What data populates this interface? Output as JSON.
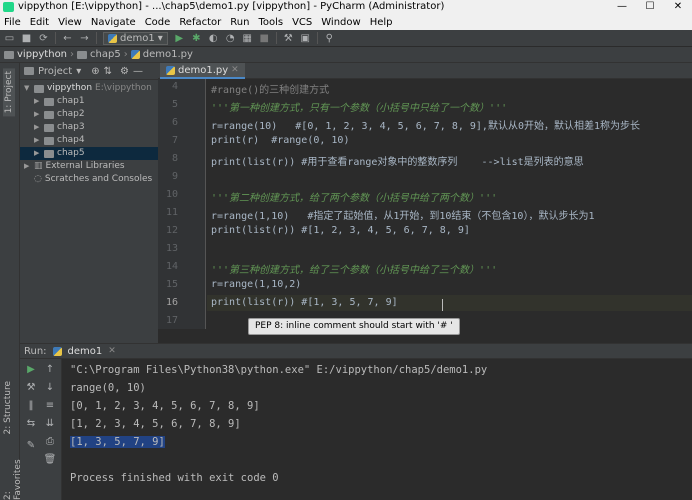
{
  "window": {
    "title": "vippython [E:\\vippython] - ...\\chap5\\demo1.py [vippython] - PyCharm (Administrator)",
    "controls": [
      "—",
      "☐",
      "✕"
    ]
  },
  "menu": [
    "File",
    "Edit",
    "View",
    "Navigate",
    "Code",
    "Refactor",
    "Run",
    "Tools",
    "VCS",
    "Window",
    "Help"
  ],
  "toolbar": {
    "run_config": "demo1"
  },
  "breadcrumb": {
    "items": [
      "vippython",
      "chap5",
      "demo1.py"
    ]
  },
  "sidebar": {
    "vertical_tabs": [
      "1: Project",
      "2: Structure",
      "2: Favorites"
    ],
    "header": {
      "label": "Project"
    },
    "root": {
      "name": "vippython",
      "path": "E:\\vippython"
    },
    "folders": [
      {
        "name": "chap1"
      },
      {
        "name": "chap2"
      },
      {
        "name": "chap3"
      },
      {
        "name": "chap4"
      },
      {
        "name": "chap5"
      }
    ],
    "external": "External Libraries",
    "scratches": "Scratches and Consoles"
  },
  "editor": {
    "tab_label": "demo1.py",
    "line_numbers": [
      "4",
      "5",
      "6",
      "7",
      "8",
      "9",
      "10",
      "11",
      "12",
      "13",
      "14",
      "15",
      "16",
      "17"
    ],
    "lines": [
      "#range()的三种创建方式",
      "'''第一种创建方式，只有一个参数（小括号中只给了一个数）'''",
      "r=range(10)   #[0, 1, 2, 3, 4, 5, 6, 7, 8, 9],默认从0开始，默认相差1称为步长",
      "print(r)  #range(0, 10)",
      "print(list(r)) #用于查看range对象中的整数序列    -->list是列表的意思",
      "",
      "'''第二种创建方式，给了两个参数（小括号中给了两个数）'''",
      "r=range(1,10)   #指定了起始值，从1开始，到10结束（不包含10），默认步长为1",
      "print(list(r)) #[1, 2, 3, 4, 5, 6, 7, 8, 9]",
      "",
      "'''第三种创建方式，给了三个参数（小括号中给了三个数）'''",
      "r=range(1,10,2)",
      "print(list(r)) #[1, 3, 5, 7, 9]",
      ""
    ],
    "tooltip": "PEP 8: inline comment should start with '# '"
  },
  "run": {
    "label": "Run:",
    "tab": "demo1",
    "output": [
      "\"C:\\Program Files\\Python38\\python.exe\" E:/vippython/chap5/demo1.py",
      "range(0, 10)",
      "[0, 1, 2, 3, 4, 5, 6, 7, 8, 9]",
      "[1, 2, 3, 4, 5, 6, 7, 8, 9]",
      "[1, 3, 5, 7, 9]",
      "",
      "Process finished with exit code 0"
    ]
  }
}
